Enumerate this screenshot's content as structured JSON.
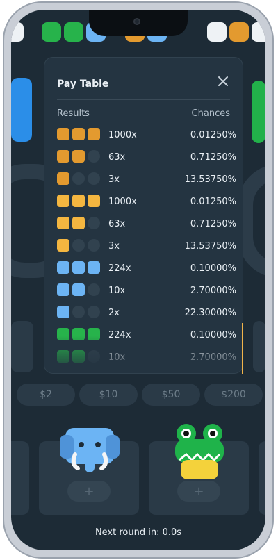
{
  "pay_table": {
    "title": "Pay Table",
    "results_header": "Results",
    "chances_header": "Chances",
    "rows": [
      {
        "animal": "bear",
        "matches": 3,
        "multiplier": "1000x",
        "chance": "0.01250%"
      },
      {
        "animal": "bear",
        "matches": 2,
        "multiplier": "63x",
        "chance": "0.71250%"
      },
      {
        "animal": "bear",
        "matches": 1,
        "multiplier": "3x",
        "chance": "13.53750%"
      },
      {
        "animal": "tiger",
        "matches": 3,
        "multiplier": "1000x",
        "chance": "0.01250%"
      },
      {
        "animal": "tiger",
        "matches": 2,
        "multiplier": "63x",
        "chance": "0.71250%"
      },
      {
        "animal": "tiger",
        "matches": 1,
        "multiplier": "3x",
        "chance": "13.53750%"
      },
      {
        "animal": "elephant",
        "matches": 3,
        "multiplier": "224x",
        "chance": "0.10000%"
      },
      {
        "animal": "elephant",
        "matches": 2,
        "multiplier": "10x",
        "chance": "2.70000%"
      },
      {
        "animal": "elephant",
        "matches": 1,
        "multiplier": "2x",
        "chance": "22.30000%"
      },
      {
        "animal": "frog",
        "matches": 3,
        "multiplier": "224x",
        "chance": "0.10000%"
      },
      {
        "animal": "frog",
        "matches": 2,
        "multiplier": "10x",
        "chance": "2.70000%"
      }
    ]
  },
  "bets": [
    "$2",
    "$10",
    "$50",
    "$200"
  ],
  "footer": {
    "next_round": "Next round in: 0.0s"
  },
  "colors": {
    "background": "#1d2b36",
    "modal": "#243441",
    "bear": "#e39a2f",
    "tiger": "#f4b640",
    "elephant": "#6cb4f4",
    "frog": "#27b34b",
    "slot": "#31424f",
    "accent": "#f0b44b"
  }
}
